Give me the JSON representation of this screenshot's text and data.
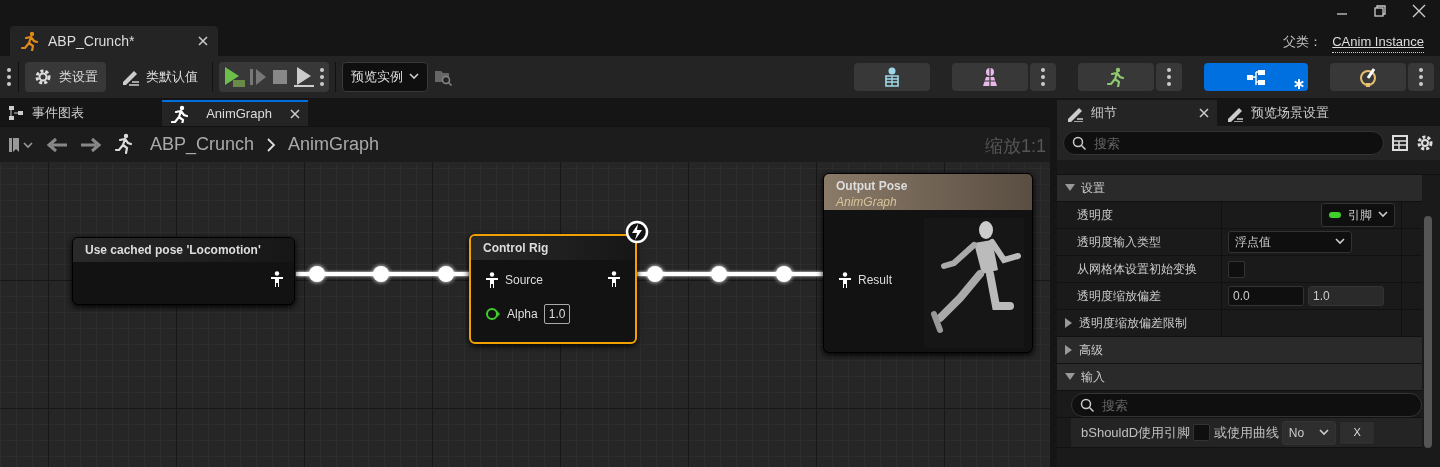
{
  "window": {
    "document_tab": {
      "title": "ABP_Crunch*"
    },
    "parent_class_label": "父类：",
    "parent_class": "CAnim Instance"
  },
  "toolbar": {
    "buttons": [
      {
        "kind": "gear",
        "label": "类设置",
        "selected": true
      },
      {
        "kind": "pencil",
        "label": "类默认值",
        "selected": false
      }
    ],
    "preview_dropdown": "预览实例",
    "mode_buttons": [
      {
        "kind": "skeleton",
        "selected": false,
        "has_menu": false
      },
      {
        "kind": "mesh",
        "selected": false,
        "has_menu": true
      },
      {
        "kind": "animation",
        "selected": false,
        "has_menu": true
      },
      {
        "kind": "graph",
        "selected": true,
        "has_menu": false
      },
      {
        "kind": "physics",
        "selected": false,
        "has_menu": true
      }
    ]
  },
  "graph_tabs": [
    {
      "kind": "event",
      "label": "事件图表",
      "selected": false
    },
    {
      "kind": "anim",
      "label": "AnimGraph",
      "selected": true
    }
  ],
  "breadcrumb": [
    "ABP_Crunch",
    "AnimGraph"
  ],
  "zoom_label": "缩放1:1",
  "nodes": [
    {
      "kind": "cached",
      "title": "Use cached pose 'Locomotion'",
      "selected": false
    },
    {
      "kind": "control-rig",
      "title": "Control Rig",
      "selected": true,
      "source_pin": "Source",
      "alpha_pin": "Alpha",
      "alpha_value": "1.0"
    },
    {
      "kind": "output",
      "title": "Output Pose",
      "subtitle": "AnimGraph",
      "selected": false,
      "result_pin": "Result"
    }
  ],
  "details": {
    "tabs": [
      {
        "label": "细节",
        "selected": true
      },
      {
        "label": "预览场景设置",
        "selected": false
      }
    ],
    "search_placeholder": "搜索",
    "rows": [
      {
        "kind": "section",
        "label": "设置",
        "expanded": true
      },
      {
        "kind": "pin-dropdown",
        "label": "透明度",
        "value": "引脚"
      },
      {
        "kind": "dropdown",
        "label": "透明度输入类型",
        "value": "浮点值"
      },
      {
        "kind": "checkbox",
        "label": "从网格体设置初始变换",
        "checked": false
      },
      {
        "kind": "pair",
        "label": "透明度缩放偏差",
        "values": [
          "0.0",
          "1.0"
        ]
      },
      {
        "kind": "group",
        "label": "透明度缩放偏差限制",
        "expanded": false
      },
      {
        "kind": "section",
        "label": "高级",
        "expanded": false
      },
      {
        "kind": "section",
        "label": "输入",
        "expanded": true
      },
      {
        "kind": "search",
        "placeholder": "搜索"
      },
      {
        "kind": "input",
        "label": "bShouldD使用引脚",
        "checked": false,
        "label2": "或使用曲线",
        "dropdown": "No",
        "button": "X"
      }
    ]
  }
}
